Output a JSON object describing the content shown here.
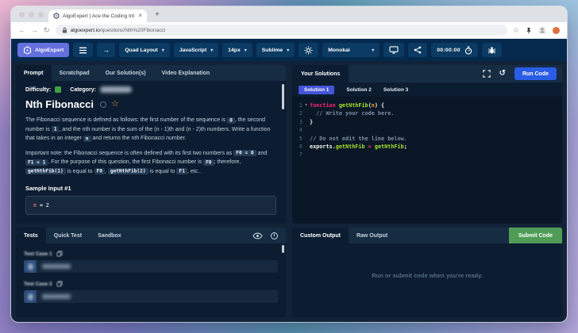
{
  "browser": {
    "tab_title": "AlgoExpert | Ace the Coding Int",
    "close_tab_label": "×",
    "new_tab_label": "+",
    "url_domain": "algoexpert.io",
    "url_path": "/questions/Nth%20Fibonacci"
  },
  "toolbar": {
    "brand": "AlgoExpert",
    "layout_dropdown": "Quad Layout",
    "language_dropdown": "JavaScript",
    "font_size_dropdown": "14px",
    "keybinding_dropdown": "Sublime",
    "theme_dropdown": "Monokai",
    "timer": "00:00:00"
  },
  "icons": {
    "caret_down": "▾",
    "back_arrow": "←",
    "forward_arrow": "→",
    "reload": "↻",
    "bookmark_star": "☆",
    "next_question_arrow": "→",
    "reset_code": "↺",
    "favorite_star": "☆",
    "info": "i"
  },
  "prompt": {
    "tabs": [
      "Prompt",
      "Scratchpad",
      "Our Solution(s)",
      "Video Explanation"
    ],
    "difficulty_label": "Difficulty:",
    "category_label": "Category:",
    "title": "Nth Fibonacci",
    "paragraphs": [
      [
        {
          "t": "The Fibonacci sequence is defined as follows: the first number of the sequence is "
        },
        {
          "c": "0"
        },
        {
          "t": ", the second number is "
        },
        {
          "c": "1"
        },
        {
          "t": ", and the nth number is the sum of the (n - 1)th and (n - 2)th numbers. Write a function that takes in an integer "
        },
        {
          "c": "n"
        },
        {
          "t": " and returns the nth Fibonacci number."
        }
      ],
      [
        {
          "t": "Important note: the Fibonacci sequence is often defined with its first two numbers as "
        },
        {
          "c": "F0 = 0"
        },
        {
          "t": " and "
        },
        {
          "c": "F1 = 1"
        },
        {
          "t": ". For the purpose of this question, the first Fibonacci number is "
        },
        {
          "c": "F0"
        },
        {
          "t": "; therefore, "
        },
        {
          "c": "getNthFib(1)"
        },
        {
          "t": " is equal to "
        },
        {
          "c": "F0"
        },
        {
          "t": ", "
        },
        {
          "c": "getNthFib(2)"
        },
        {
          "t": " is equal to "
        },
        {
          "c": "F1"
        },
        {
          "t": ", etc.."
        }
      ]
    ],
    "sample_input_label": "Sample Input #1",
    "sample_input_tokens": [
      {
        "t": "n",
        "c": "#e06c75"
      },
      {
        "t": " = ",
        "c": "#cdd7e3"
      },
      {
        "t": "2",
        "c": "#cdd7e3"
      }
    ]
  },
  "solutions": {
    "header": "Your Solutions",
    "tabs": [
      "Solution 1",
      "Solution 2",
      "Solution 3"
    ],
    "run_button": "Run Code"
  },
  "editor": {
    "lines": [
      {
        "num": "1",
        "fold": true,
        "tokens": [
          {
            "t": "function ",
            "c": "#f92672"
          },
          {
            "t": "getNthFib",
            "c": "#a6e22e"
          },
          {
            "t": "(",
            "c": "#f8f8f2"
          },
          {
            "t": "n",
            "c": "#fd971f"
          },
          {
            "t": ") {",
            "c": "#f8f8f2"
          }
        ]
      },
      {
        "num": "2",
        "tokens": [
          {
            "t": "  // Write your code here.",
            "c": "#7d8fa3"
          }
        ]
      },
      {
        "num": "3",
        "tokens": [
          {
            "t": "}",
            "c": "#f8f8f2"
          }
        ]
      },
      {
        "num": "4",
        "tokens": []
      },
      {
        "num": "5",
        "tokens": [
          {
            "t": "// Do not edit the line below.",
            "c": "#7d8fa3"
          }
        ]
      },
      {
        "num": "6",
        "tokens": [
          {
            "t": "exports",
            "c": "#f8f8f2",
            "b": true
          },
          {
            "t": ".",
            "c": "#f8f8f2"
          },
          {
            "t": "getNthFib",
            "c": "#a6e22e"
          },
          {
            "t": " = ",
            "c": "#f92672"
          },
          {
            "t": "getNthFib",
            "c": "#a6e22e"
          },
          {
            "t": ";",
            "c": "#f8f8f2"
          }
        ]
      },
      {
        "num": "7",
        "tokens": []
      }
    ]
  },
  "tests": {
    "tabs": [
      "Tests",
      "Quick Test",
      "Sandbox"
    ],
    "cases": [
      {
        "label": "Test Case 1"
      },
      {
        "label": "Test Case 2"
      }
    ]
  },
  "output": {
    "tabs": [
      "Custom Output",
      "Raw Output"
    ],
    "submit_button": "Submit Code",
    "empty_message": "Run or submit code when you're ready."
  },
  "colors": {
    "run_button": "#2b5ce5",
    "submit_button": "#4f9d55",
    "solution_pill": "#4355d8",
    "difficulty": "#43a047",
    "brand": "#6470de"
  }
}
